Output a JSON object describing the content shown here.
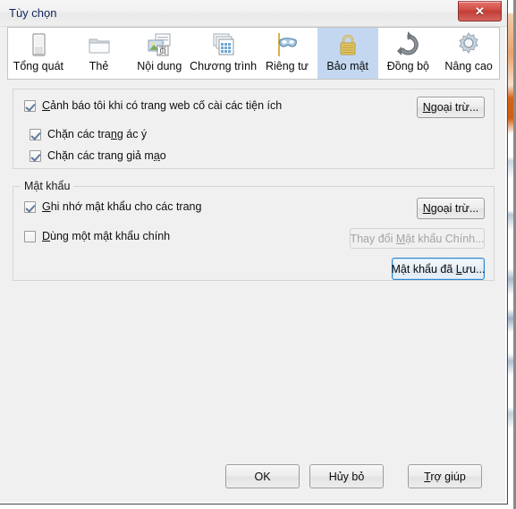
{
  "window": {
    "title": "Tùy chọn",
    "close_label": "✕",
    "close_icon": "close-icon"
  },
  "tabs": [
    {
      "label": "Tổng quát",
      "icon": "general-icon",
      "selected": false
    },
    {
      "label": "Thẻ",
      "icon": "tabs-folder-icon",
      "selected": false
    },
    {
      "label": "Nội dung",
      "icon": "content-icon",
      "selected": false
    },
    {
      "label": "Chương trình",
      "icon": "applications-icon",
      "selected": false
    },
    {
      "label": "Riêng tư",
      "icon": "privacy-mask-icon",
      "selected": false
    },
    {
      "label": "Bảo mật",
      "icon": "security-lock-icon",
      "selected": true
    },
    {
      "label": "Đồng bộ",
      "icon": "sync-icon",
      "selected": false
    },
    {
      "label": "Nâng cao",
      "icon": "advanced-gear-icon",
      "selected": false
    }
  ],
  "warnings_group": {
    "title": "",
    "checkboxes": [
      {
        "pre": "",
        "acc": "C",
        "post": "ảnh báo tôi khi có trang web cố cài các tiện ích",
        "checked": true
      },
      {
        "pre": "Chặn các tra",
        "acc": "n",
        "post": "g ác ý",
        "checked": true
      },
      {
        "pre": "Chặn các trang giả m",
        "acc": "ạ",
        "post": "o",
        "checked": true
      }
    ],
    "exceptions_button": {
      "pre": "",
      "acc": "N",
      "post": "goại trừ...",
      "enabled": true
    }
  },
  "passwords_group": {
    "title": "Mật khẩu",
    "checkboxes": [
      {
        "pre": "",
        "acc": "G",
        "post": "hi nhớ mật khẩu cho các trang",
        "checked": true
      },
      {
        "pre": "",
        "acc": "D",
        "post": "ùng một mật khẩu chính",
        "checked": false
      }
    ],
    "exceptions_button": {
      "pre": "",
      "acc": "N",
      "post": "goại trừ...",
      "enabled": true
    },
    "change_master_button": {
      "pre": "Thay đổi ",
      "acc": "M",
      "post": "ật khẩu Chính...",
      "enabled": false
    },
    "saved_passwords_button": {
      "pre": "Mật khẩu đã ",
      "acc": "L",
      "post": "ưu...",
      "enabled": true,
      "focused": true
    }
  },
  "footer": {
    "ok": {
      "pre": "OK",
      "acc": "",
      "post": ""
    },
    "cancel": {
      "pre": "Hủy bỏ",
      "acc": "",
      "post": ""
    },
    "help": {
      "pre": "",
      "acc": "T",
      "post": "rợ giúp"
    }
  },
  "colors": {
    "dialog_background": "#f0f0f0",
    "selected_tab": "#c3d8f0",
    "title_text": "#12255c",
    "close_button": "#c03d37",
    "focus_border": "#2f87d0",
    "group_border": "#d4d4d4",
    "disabled_text": "#a4a4a4"
  }
}
